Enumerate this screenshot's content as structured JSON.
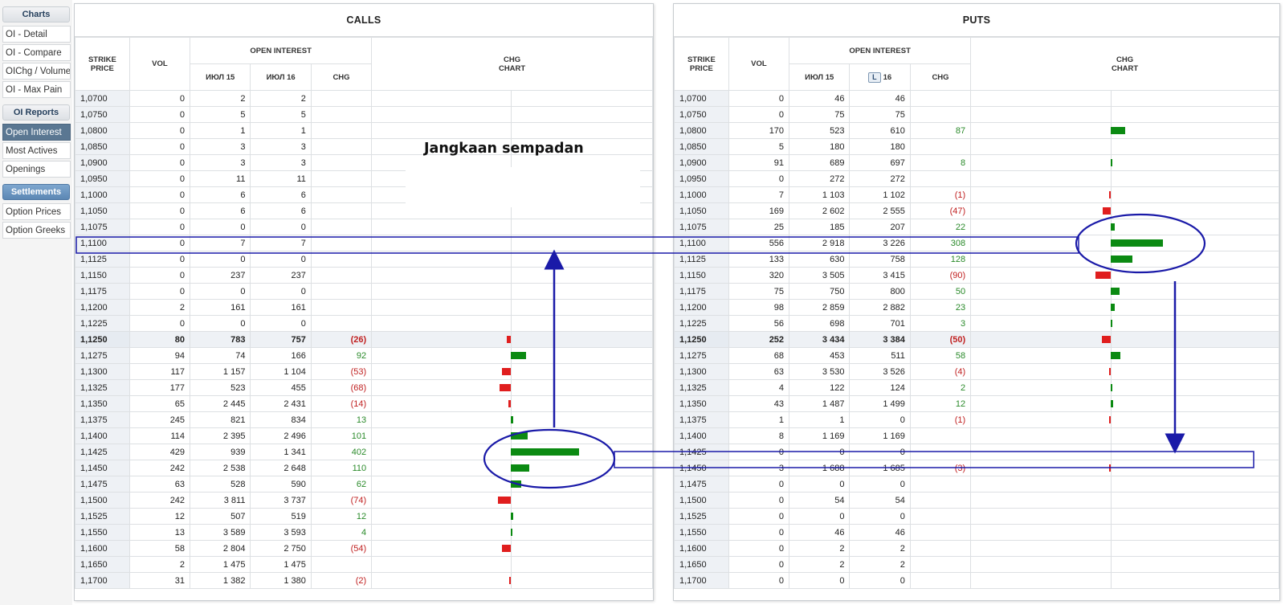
{
  "sidebar": {
    "charts_header": "Charts",
    "charts_items": [
      "OI - Detail",
      "OI - Compare",
      "OIChg / Volume",
      "OI - Max Pain"
    ],
    "reports_header": "OI Reports",
    "reports_items": [
      "Open Interest",
      "Most Actives",
      "Openings"
    ],
    "selected_report": "Open Interest",
    "settlements_header": "Settlements",
    "settlements_items": [
      "Option Prices",
      "Option Greeks"
    ]
  },
  "calls": {
    "title": "CALLS",
    "headers": {
      "strike": "STRIKE PRICE",
      "vol": "VOL",
      "open_interest": "OPEN INTEREST",
      "jul15": "ИЮЛ 15",
      "jul16": "ИЮЛ 16",
      "chg": "CHG",
      "chg_chart": "CHG CHART"
    },
    "rows": [
      {
        "strike": "1,0700",
        "vol": "0",
        "jul15": "2",
        "jul16": "2",
        "chg": "",
        "chg_value": 0
      },
      {
        "strike": "1,0750",
        "vol": "0",
        "jul15": "5",
        "jul16": "5",
        "chg": "",
        "chg_value": 0
      },
      {
        "strike": "1,0800",
        "vol": "0",
        "jul15": "1",
        "jul16": "1",
        "chg": "",
        "chg_value": 0
      },
      {
        "strike": "1,0850",
        "vol": "0",
        "jul15": "3",
        "jul16": "3",
        "chg": "",
        "chg_value": 0
      },
      {
        "strike": "1,0900",
        "vol": "0",
        "jul15": "3",
        "jul16": "3",
        "chg": "",
        "chg_value": 0
      },
      {
        "strike": "1,0950",
        "vol": "0",
        "jul15": "11",
        "jul16": "11",
        "chg": "",
        "chg_value": 0
      },
      {
        "strike": "1,1000",
        "vol": "0",
        "jul15": "6",
        "jul16": "6",
        "chg": "",
        "chg_value": 0
      },
      {
        "strike": "1,1050",
        "vol": "0",
        "jul15": "6",
        "jul16": "6",
        "chg": "",
        "chg_value": 0
      },
      {
        "strike": "1,1075",
        "vol": "0",
        "jul15": "0",
        "jul16": "0",
        "chg": "",
        "chg_value": 0
      },
      {
        "strike": "1,1100",
        "vol": "0",
        "jul15": "7",
        "jul16": "7",
        "chg": "",
        "chg_value": 0
      },
      {
        "strike": "1,1125",
        "vol": "0",
        "jul15": "0",
        "jul16": "0",
        "chg": "",
        "chg_value": 0
      },
      {
        "strike": "1,1150",
        "vol": "0",
        "jul15": "237",
        "jul16": "237",
        "chg": "",
        "chg_value": 0
      },
      {
        "strike": "1,1175",
        "vol": "0",
        "jul15": "0",
        "jul16": "0",
        "chg": "",
        "chg_value": 0
      },
      {
        "strike": "1,1200",
        "vol": "2",
        "jul15": "161",
        "jul16": "161",
        "chg": "",
        "chg_value": 0
      },
      {
        "strike": "1,1225",
        "vol": "0",
        "jul15": "0",
        "jul16": "0",
        "chg": "",
        "chg_value": 0
      },
      {
        "strike": "1,1250",
        "vol": "80",
        "jul15": "783",
        "jul16": "757",
        "chg": "(26)",
        "chg_value": -26,
        "atm": true
      },
      {
        "strike": "1,1275",
        "vol": "94",
        "jul15": "74",
        "jul16": "166",
        "chg": "92",
        "chg_value": 92
      },
      {
        "strike": "1,1300",
        "vol": "117",
        "jul15": "1 157",
        "jul16": "1 104",
        "chg": "(53)",
        "chg_value": -53
      },
      {
        "strike": "1,1325",
        "vol": "177",
        "jul15": "523",
        "jul16": "455",
        "chg": "(68)",
        "chg_value": -68
      },
      {
        "strike": "1,1350",
        "vol": "65",
        "jul15": "2 445",
        "jul16": "2 431",
        "chg": "(14)",
        "chg_value": -14
      },
      {
        "strike": "1,1375",
        "vol": "245",
        "jul15": "821",
        "jul16": "834",
        "chg": "13",
        "chg_value": 13
      },
      {
        "strike": "1,1400",
        "vol": "114",
        "jul15": "2 395",
        "jul16": "2 496",
        "chg": "101",
        "chg_value": 101
      },
      {
        "strike": "1,1425",
        "vol": "429",
        "jul15": "939",
        "jul16": "1 341",
        "chg": "402",
        "chg_value": 402
      },
      {
        "strike": "1,1450",
        "vol": "242",
        "jul15": "2 538",
        "jul16": "2 648",
        "chg": "110",
        "chg_value": 110
      },
      {
        "strike": "1,1475",
        "vol": "63",
        "jul15": "528",
        "jul16": "590",
        "chg": "62",
        "chg_value": 62
      },
      {
        "strike": "1,1500",
        "vol": "242",
        "jul15": "3 811",
        "jul16": "3 737",
        "chg": "(74)",
        "chg_value": -74
      },
      {
        "strike": "1,1525",
        "vol": "12",
        "jul15": "507",
        "jul16": "519",
        "chg": "12",
        "chg_value": 12
      },
      {
        "strike": "1,1550",
        "vol": "13",
        "jul15": "3 589",
        "jul16": "3 593",
        "chg": "4",
        "chg_value": 4
      },
      {
        "strike": "1,1600",
        "vol": "58",
        "jul15": "2 804",
        "jul16": "2 750",
        "chg": "(54)",
        "chg_value": -54
      },
      {
        "strike": "1,1650",
        "vol": "2",
        "jul15": "1 475",
        "jul16": "1 475",
        "chg": "",
        "chg_value": 0
      },
      {
        "strike": "1,1700",
        "vol": "31",
        "jul15": "1 382",
        "jul16": "1 380",
        "chg": "(2)",
        "chg_value": -2
      }
    ]
  },
  "puts": {
    "title": "PUTS",
    "headers": {
      "strike": "STRIKE PRICE",
      "vol": "VOL",
      "open_interest": "OPEN INTEREST",
      "jul15": "ИЮЛ 15",
      "jul16_button": "L",
      "jul16": "16",
      "chg": "CHG",
      "chg_chart": "CHG CHART"
    },
    "rows": [
      {
        "strike": "1,0700",
        "vol": "0",
        "jul15": "46",
        "jul16": "46",
        "chg": "",
        "chg_value": 0
      },
      {
        "strike": "1,0750",
        "vol": "0",
        "jul15": "75",
        "jul16": "75",
        "chg": "",
        "chg_value": 0
      },
      {
        "strike": "1,0800",
        "vol": "170",
        "jul15": "523",
        "jul16": "610",
        "chg": "87",
        "chg_value": 87
      },
      {
        "strike": "1,0850",
        "vol": "5",
        "jul15": "180",
        "jul16": "180",
        "chg": "",
        "chg_value": 0
      },
      {
        "strike": "1,0900",
        "vol": "91",
        "jul15": "689",
        "jul16": "697",
        "chg": "8",
        "chg_value": 8
      },
      {
        "strike": "1,0950",
        "vol": "0",
        "jul15": "272",
        "jul16": "272",
        "chg": "",
        "chg_value": 0
      },
      {
        "strike": "1,1000",
        "vol": "7",
        "jul15": "1 103",
        "jul16": "1 102",
        "chg": "(1)",
        "chg_value": -1
      },
      {
        "strike": "1,1050",
        "vol": "169",
        "jul15": "2 602",
        "jul16": "2 555",
        "chg": "(47)",
        "chg_value": -47
      },
      {
        "strike": "1,1075",
        "vol": "25",
        "jul15": "185",
        "jul16": "207",
        "chg": "22",
        "chg_value": 22
      },
      {
        "strike": "1,1100",
        "vol": "556",
        "jul15": "2 918",
        "jul16": "3 226",
        "chg": "308",
        "chg_value": 308
      },
      {
        "strike": "1,1125",
        "vol": "133",
        "jul15": "630",
        "jul16": "758",
        "chg": "128",
        "chg_value": 128
      },
      {
        "strike": "1,1150",
        "vol": "320",
        "jul15": "3 505",
        "jul16": "3 415",
        "chg": "(90)",
        "chg_value": -90
      },
      {
        "strike": "1,1175",
        "vol": "75",
        "jul15": "750",
        "jul16": "800",
        "chg": "50",
        "chg_value": 50
      },
      {
        "strike": "1,1200",
        "vol": "98",
        "jul15": "2 859",
        "jul16": "2 882",
        "chg": "23",
        "chg_value": 23
      },
      {
        "strike": "1,1225",
        "vol": "56",
        "jul15": "698",
        "jul16": "701",
        "chg": "3",
        "chg_value": 3
      },
      {
        "strike": "1,1250",
        "vol": "252",
        "jul15": "3 434",
        "jul16": "3 384",
        "chg": "(50)",
        "chg_value": -50,
        "atm": true
      },
      {
        "strike": "1,1275",
        "vol": "68",
        "jul15": "453",
        "jul16": "511",
        "chg": "58",
        "chg_value": 58
      },
      {
        "strike": "1,1300",
        "vol": "63",
        "jul15": "3 530",
        "jul16": "3 526",
        "chg": "(4)",
        "chg_value": -4
      },
      {
        "strike": "1,1325",
        "vol": "4",
        "jul15": "122",
        "jul16": "124",
        "chg": "2",
        "chg_value": 2
      },
      {
        "strike": "1,1350",
        "vol": "43",
        "jul15": "1 487",
        "jul16": "1 499",
        "chg": "12",
        "chg_value": 12
      },
      {
        "strike": "1,1375",
        "vol": "1",
        "jul15": "1",
        "jul16": "0",
        "chg": "(1)",
        "chg_value": -1
      },
      {
        "strike": "1,1400",
        "vol": "8",
        "jul15": "1 169",
        "jul16": "1 169",
        "chg": "",
        "chg_value": 0
      },
      {
        "strike": "1,1425",
        "vol": "0",
        "jul15": "0",
        "jul16": "0",
        "chg": "",
        "chg_value": 0
      },
      {
        "strike": "1,1450",
        "vol": "3",
        "jul15": "1 688",
        "jul16": "1 685",
        "chg": "(3)",
        "chg_value": -3
      },
      {
        "strike": "1,1475",
        "vol": "0",
        "jul15": "0",
        "jul16": "0",
        "chg": "",
        "chg_value": 0
      },
      {
        "strike": "1,1500",
        "vol": "0",
        "jul15": "54",
        "jul16": "54",
        "chg": "",
        "chg_value": 0
      },
      {
        "strike": "1,1525",
        "vol": "0",
        "jul15": "0",
        "jul16": "0",
        "chg": "",
        "chg_value": 0
      },
      {
        "strike": "1,1550",
        "vol": "0",
        "jul15": "46",
        "jul16": "46",
        "chg": "",
        "chg_value": 0
      },
      {
        "strike": "1,1600",
        "vol": "0",
        "jul15": "2",
        "jul16": "2",
        "chg": "",
        "chg_value": 0
      },
      {
        "strike": "1,1650",
        "vol": "0",
        "jul15": "2",
        "jul16": "2",
        "chg": "",
        "chg_value": 0
      },
      {
        "strike": "1,1700",
        "vol": "0",
        "jul15": "0",
        "jul16": "0",
        "chg": "",
        "chg_value": 0
      }
    ]
  },
  "annotation": {
    "label": "Jangkaan sempadan",
    "color": "#1a1aa8",
    "highlight_strikes": [
      "1,1100",
      "1,1425"
    ]
  },
  "colors": {
    "positive": "#0b8a12",
    "negative": "#e01e1e",
    "selected_nav": "#5a7792",
    "settlements_header": "#5c87b4"
  }
}
